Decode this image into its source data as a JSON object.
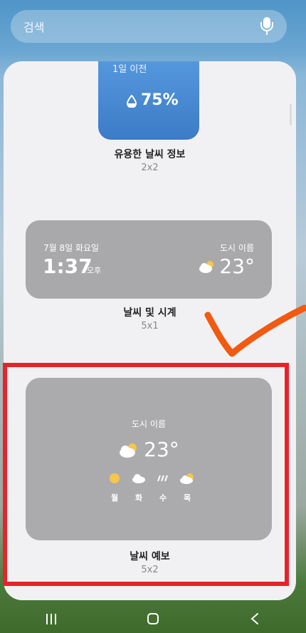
{
  "search": {
    "placeholder": "검색"
  },
  "widgets": [
    {
      "partial_text": "1일 이전",
      "humidity": "75%",
      "name": "유용한 날씨 정보",
      "size": "2x2",
      "color": "#4a8ad6"
    },
    {
      "date": "7월 8일 화요일",
      "time": "1:37",
      "ampm": "오후",
      "city": "도시 이름",
      "temp": "23°",
      "name": "날씨 및 시계",
      "size": "5x1"
    },
    {
      "city": "도시 이름",
      "temp": "23°",
      "days": [
        {
          "label": "월",
          "icon": "sun-icon"
        },
        {
          "label": "화",
          "icon": "cloud-icon"
        },
        {
          "label": "수",
          "icon": "rain-icon"
        },
        {
          "label": "목",
          "icon": "partly-cloudy-icon"
        }
      ],
      "name": "날씨 예보",
      "size": "5x2"
    }
  ],
  "annotation": {
    "highlight_color": "#e8222a",
    "check_color": "#f15a10"
  }
}
